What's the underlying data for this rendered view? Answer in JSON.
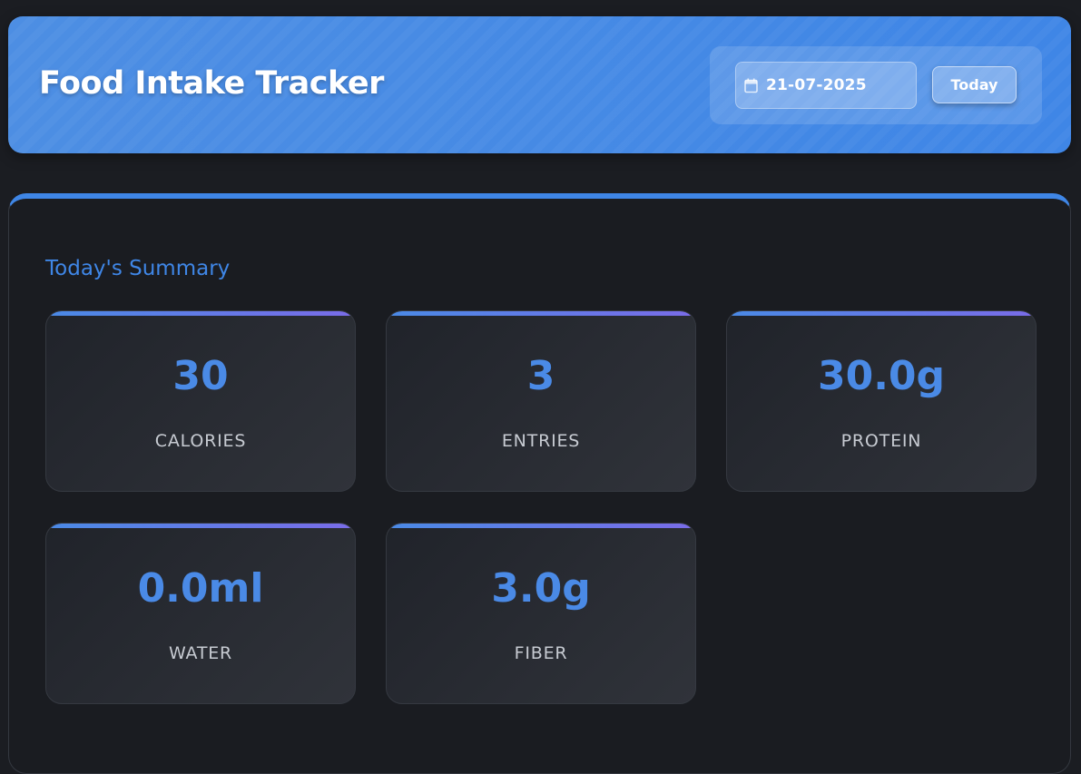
{
  "header": {
    "title": "Food Intake Tracker",
    "date_value": "21-07-2025",
    "today_label": "Today"
  },
  "summary": {
    "title": "Today's Summary",
    "stats": [
      {
        "value": "30",
        "label": "CALORIES"
      },
      {
        "value": "3",
        "label": "ENTRIES"
      },
      {
        "value": "30.0g",
        "label": "PROTEIN"
      },
      {
        "value": "0.0ml",
        "label": "WATER"
      },
      {
        "value": "3.0g",
        "label": "FIBER"
      }
    ]
  },
  "icons": {
    "date_input": "calendar-icon"
  },
  "colors": {
    "accent": "#3f86e6",
    "background": "#1b1d22",
    "stat_gradient_end": "#7a6ce8"
  }
}
